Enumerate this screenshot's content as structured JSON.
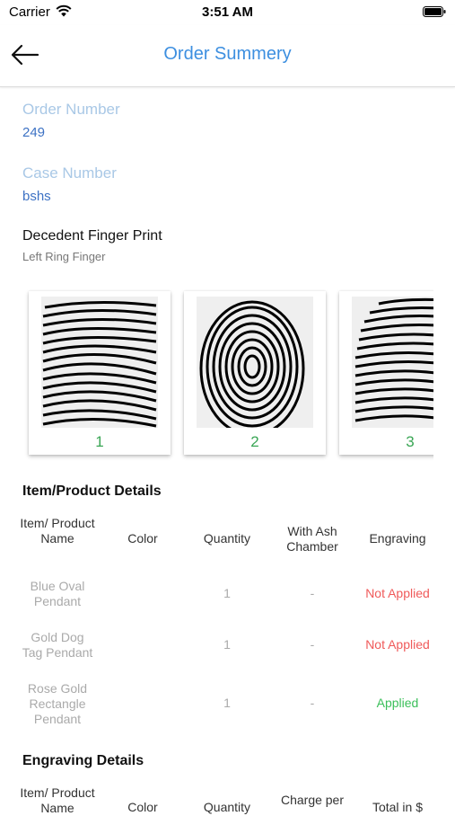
{
  "status": {
    "carrier": "Carrier",
    "time": "3:51 AM"
  },
  "nav": {
    "title": "Order Summery"
  },
  "order": {
    "number_label": "Order Number",
    "number_value": "249",
    "case_label": "Case Number",
    "case_value": "bshs"
  },
  "fingerprint": {
    "heading": "Decedent Finger Print",
    "finger": "Left Ring Finger",
    "cards": [
      "1",
      "2",
      "3"
    ]
  },
  "items": {
    "heading": "Item/Product Details",
    "headers": [
      "Item/ Product Name",
      "Color",
      "Quantity",
      "With Ash Chamber",
      "Engraving"
    ],
    "rows": [
      {
        "name": "Blue Oval Pendant",
        "color": "",
        "quantity": "1",
        "ash": "-",
        "engraving": "Not Applied"
      },
      {
        "name": "Gold Dog Tag Pendant",
        "color": "",
        "quantity": "1",
        "ash": "-",
        "engraving": "Not Applied"
      },
      {
        "name": "Rose Gold Rectangle Pendant",
        "color": "",
        "quantity": "1",
        "ash": "-",
        "engraving": "Applied"
      }
    ]
  },
  "engraving": {
    "heading": "Engraving Details",
    "headers": [
      "Item/ Product Name",
      "Color",
      "Quantity",
      "Charge per",
      "Total in $"
    ]
  },
  "colors": {
    "accent": "#3d8fe0",
    "value_blue": "#3d72c4",
    "label_blue": "#a9c8e6",
    "red": "#f05a5a",
    "green": "#3bbf5a",
    "card_num": "#3aa655"
  }
}
